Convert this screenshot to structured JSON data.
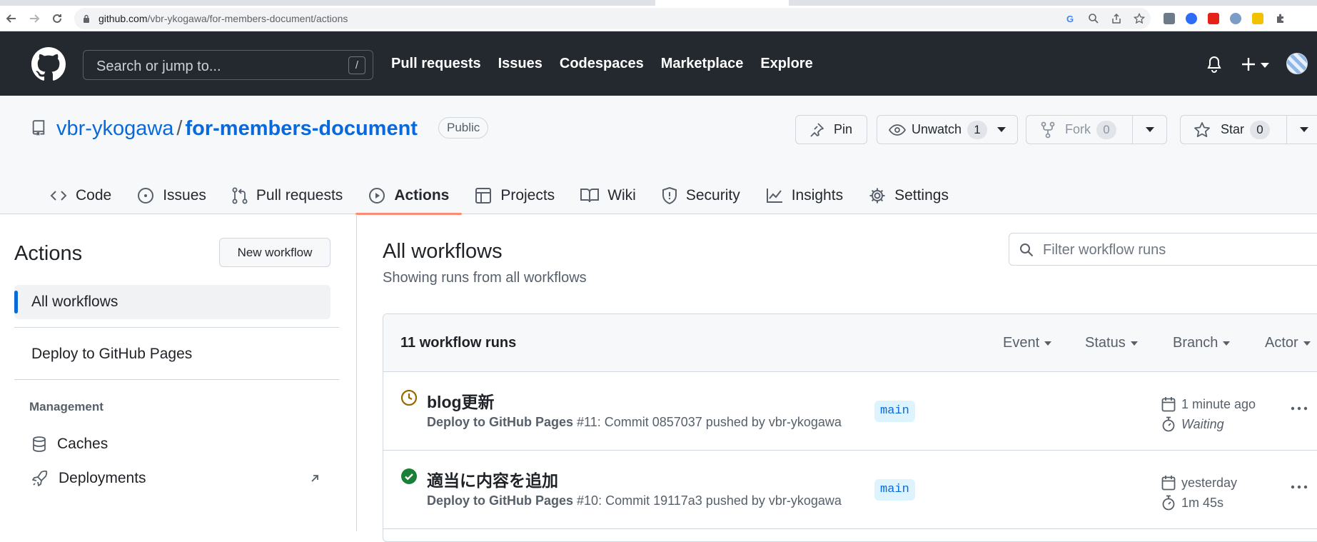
{
  "browser": {
    "url_host": "github.com",
    "url_path": "/vbr-ykogawa/for-members-document/actions"
  },
  "header": {
    "search_placeholder": "Search or jump to...",
    "search_shortcut": "/",
    "nav": [
      "Pull requests",
      "Issues",
      "Codespaces",
      "Marketplace",
      "Explore"
    ]
  },
  "repo": {
    "owner": "vbr-ykogawa",
    "separator": "/",
    "name": "for-members-document",
    "visibility": "Public",
    "pin_label": "Pin",
    "unwatch_label": "Unwatch",
    "watch_count": "1",
    "fork_label": "Fork",
    "fork_count": "0",
    "star_label": "Star",
    "star_count": "0",
    "tabs": [
      {
        "label": "Code",
        "icon": "code-icon"
      },
      {
        "label": "Issues",
        "icon": "issue-opened-icon"
      },
      {
        "label": "Pull requests",
        "icon": "git-pull-request-icon"
      },
      {
        "label": "Actions",
        "icon": "play-icon",
        "active": true
      },
      {
        "label": "Projects",
        "icon": "table-icon"
      },
      {
        "label": "Wiki",
        "icon": "book-icon"
      },
      {
        "label": "Security",
        "icon": "shield-icon"
      },
      {
        "label": "Insights",
        "icon": "graph-icon"
      },
      {
        "label": "Settings",
        "icon": "gear-icon"
      }
    ]
  },
  "sidebar": {
    "title": "Actions",
    "new_workflow": "New workflow",
    "items": [
      "All workflows",
      "Deploy to GitHub Pages"
    ],
    "management_heading": "Management",
    "management": [
      "Caches",
      "Deployments"
    ]
  },
  "main": {
    "title": "All workflows",
    "subtitle": "Showing runs from all workflows",
    "filter_placeholder": "Filter workflow runs",
    "runs_count": "11 workflow runs",
    "filters": [
      "Event",
      "Status",
      "Branch",
      "Actor"
    ],
    "runs": [
      {
        "title": "blog更新",
        "workflow": "Deploy to GitHub Pages",
        "detail": " #11: Commit 0857037 pushed by vbr-ykogawa",
        "branch": "main",
        "time": "1 minute ago",
        "duration": "Waiting",
        "status": "waiting",
        "status_color": "#9a6700"
      },
      {
        "title": "適当に内容を追加",
        "workflow": "Deploy to GitHub Pages",
        "detail": " #10: Commit 19117a3 pushed by vbr-ykogawa",
        "branch": "main",
        "time": "yesterday",
        "duration": "1m 45s",
        "status": "success",
        "status_color": "#1a7f37"
      }
    ]
  }
}
